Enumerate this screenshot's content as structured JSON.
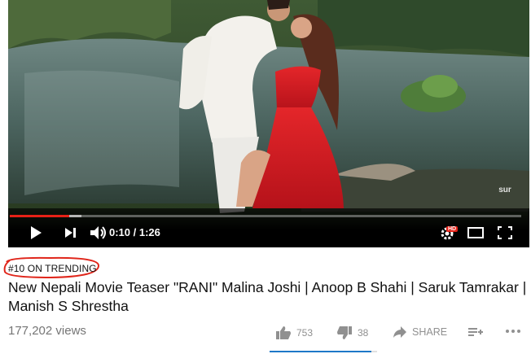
{
  "player": {
    "time_display": "0:10 / 1:26",
    "progress_fraction": 0.116,
    "buffered_fraction": 0.14,
    "watermark": "sur",
    "hd_badge": "HD",
    "icons": {
      "play": "play-icon",
      "next": "next-icon",
      "volume": "volume-icon",
      "settings": "settings-gear-icon",
      "theater": "theater-mode-icon",
      "fullscreen": "fullscreen-icon"
    },
    "accent_color": "#e62117"
  },
  "video_info": {
    "trending_label": "#10 ON TRENDING",
    "trending_ring_color": "#e0261b",
    "title": "New Nepali Movie Teaser \"RANI\" Malina Joshi | Anoop B Shahi | Saruk Tamrakar | Manish S Shrestha",
    "views": "177,202 views",
    "likes": "753",
    "dislikes": "38",
    "share_label": "SHARE",
    "sentiment_fraction": 0.95,
    "sentiment_color": "#1e78c8"
  }
}
